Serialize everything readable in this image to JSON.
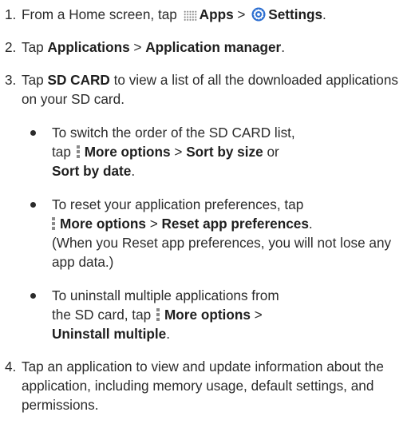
{
  "steps": [
    {
      "num": "1.",
      "t1": "From a Home screen, tap",
      "apps_label": "Apps",
      "sep": ">",
      "settings_label": "Settings",
      "end": "."
    },
    {
      "num": "2.",
      "t1": "Tap",
      "b1": "Applications",
      "sep": ">",
      "b2": "Application manager",
      "end": "."
    },
    {
      "num": "3.",
      "t1": "Tap",
      "b1": "SD CARD",
      "t2": "to view a list of all the downloaded applications on your SD card.",
      "bullets": [
        {
          "line1": "To switch the order of the SD CARD list,",
          "tap": "tap",
          "more": "More options",
          "sep": ">",
          "b2": "Sort by size",
          "or": "or",
          "b3": "Sort by date",
          "end": "."
        },
        {
          "line1": "To reset your application preferences, tap",
          "more": "More options",
          "sep": ">",
          "b2": "Reset app preferences",
          "end": ".",
          "note": "(When you Reset app preferences, you will not lose any app data.)"
        },
        {
          "line1": "To uninstall multiple applications from",
          "line2": "the SD card, tap",
          "more": "More options",
          "sep": ">",
          "b2": "Uninstall multiple",
          "end": "."
        }
      ]
    },
    {
      "num": "4.",
      "text": "Tap an application to view and update information about the application, including memory usage, default settings, and permissions."
    }
  ]
}
